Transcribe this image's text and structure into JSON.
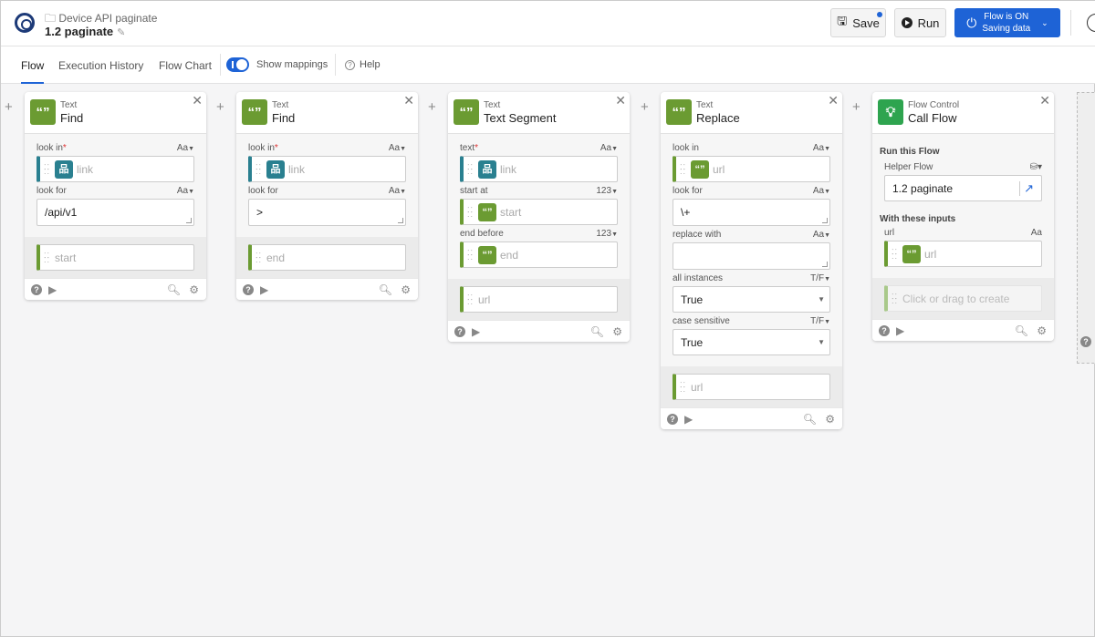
{
  "header": {
    "folder": "Device API paginate",
    "flow_name": "1.2 paginate",
    "save": "Save",
    "run": "Run",
    "flow_on_line1": "Flow is ON",
    "flow_on_line2": "Saving data"
  },
  "tabs": {
    "flow": "Flow",
    "history": "Execution History",
    "chart": "Flow Chart",
    "mappings": "Show mappings",
    "help": "Help",
    "mappings_on": true
  },
  "colors": {
    "accent": "#1e63d6",
    "text_green": "#6b9b32",
    "flow_green": "#2ea44f",
    "ref_teal": "#2a8090"
  },
  "cards": [
    {
      "category": "Text",
      "name": "Find",
      "icon": "quote-icon",
      "inputs": [
        {
          "label": "look in",
          "required": true,
          "type": "Aa",
          "kind": "ref",
          "pill": "link",
          "value": "link"
        },
        {
          "label": "look for",
          "type": "Aa",
          "kind": "textarea",
          "value": "/api/v1"
        }
      ],
      "output": "start"
    },
    {
      "category": "Text",
      "name": "Find",
      "icon": "quote-icon",
      "inputs": [
        {
          "label": "look in",
          "required": true,
          "type": "Aa",
          "kind": "ref",
          "pill": "link",
          "value": "link"
        },
        {
          "label": "look for",
          "type": "Aa",
          "kind": "textarea",
          "value": ">"
        }
      ],
      "output": "end"
    },
    {
      "category": "Text",
      "name": "Text Segment",
      "icon": "quote-icon",
      "inputs": [
        {
          "label": "text",
          "required": true,
          "type": "Aa",
          "kind": "ref",
          "pill": "link",
          "value": "link"
        },
        {
          "label": "start at",
          "type": "123",
          "kind": "ref",
          "pill": "quote",
          "value": "start"
        },
        {
          "label": "end before",
          "type": "123",
          "kind": "ref",
          "pill": "quote",
          "value": "end"
        }
      ],
      "output": "url"
    },
    {
      "category": "Text",
      "name": "Replace",
      "icon": "quote-icon",
      "inputs": [
        {
          "label": "look in",
          "type": "Aa",
          "kind": "ref",
          "pill": "quote",
          "value": "url"
        },
        {
          "label": "look for",
          "type": "Aa",
          "kind": "textarea",
          "value": "\\+"
        },
        {
          "label": "replace with",
          "type": "Aa",
          "kind": "textarea",
          "value": ""
        },
        {
          "label": "all instances",
          "type": "T/F",
          "kind": "select",
          "value": "True"
        },
        {
          "label": "case sensitive",
          "type": "T/F",
          "kind": "select",
          "value": "True"
        }
      ],
      "output": "url"
    }
  ],
  "call_flow": {
    "category": "Flow Control",
    "name": "Call Flow",
    "run_title": "Run this Flow",
    "helper_label": "Helper Flow",
    "helper_value": "1.2 paginate",
    "inputs_title": "With these inputs",
    "input_label": "url",
    "input_type": "Aa",
    "input_value": "url",
    "output_placeholder": "Click or drag to create"
  }
}
